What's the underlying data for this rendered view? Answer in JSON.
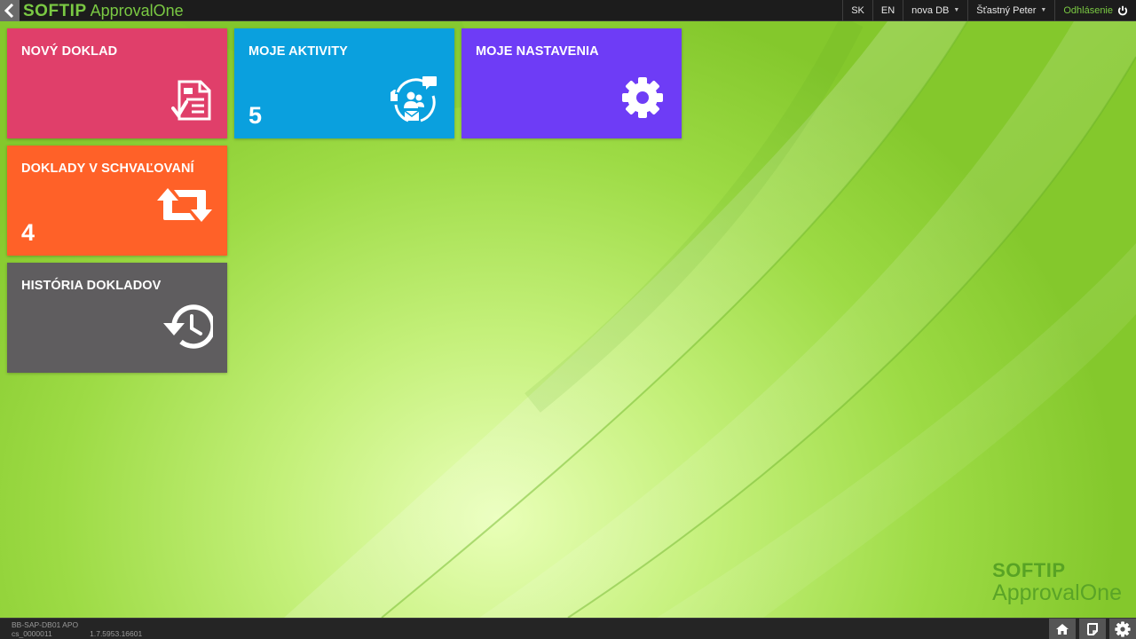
{
  "app": {
    "brand": "SOFTIP",
    "product": "ApprovalOne"
  },
  "topbar": {
    "lang_sk": "SK",
    "lang_en": "EN",
    "database": "nova DB",
    "user": "Šťastný Peter",
    "logout": "Odhlásenie"
  },
  "tiles": [
    {
      "title": "NOVÝ DOKLAD",
      "count": "",
      "color": "#e03f6a",
      "icon": "document-check-icon"
    },
    {
      "title": "MOJE AKTIVITY",
      "count": "5",
      "color": "#0aa0de",
      "icon": "activities-icon"
    },
    {
      "title": "MOJE NASTAVENIA",
      "count": "",
      "color": "#6e3cf6",
      "icon": "gear-icon"
    },
    {
      "title": "DOKLADY V SCHVAĽOVANÍ",
      "count": "4",
      "color": "#ff6128",
      "icon": "retweet-icon"
    },
    {
      "title": "HISTÓRIA DOKLADOV",
      "count": "",
      "color": "#5f5d5f",
      "icon": "history-icon"
    }
  ],
  "watermark": {
    "brand": "SOFTIP",
    "product": "ApprovalOne"
  },
  "statusbar": {
    "server": "BB-SAP-DB01 APO",
    "company": "cs_0000011",
    "version": "1.7.5953.16601",
    "buttons": [
      "home-icon",
      "notes-icon",
      "gear-icon"
    ]
  },
  "colors": {
    "accent": "#7ac943",
    "topbar_bg": "#1c1c1c"
  }
}
